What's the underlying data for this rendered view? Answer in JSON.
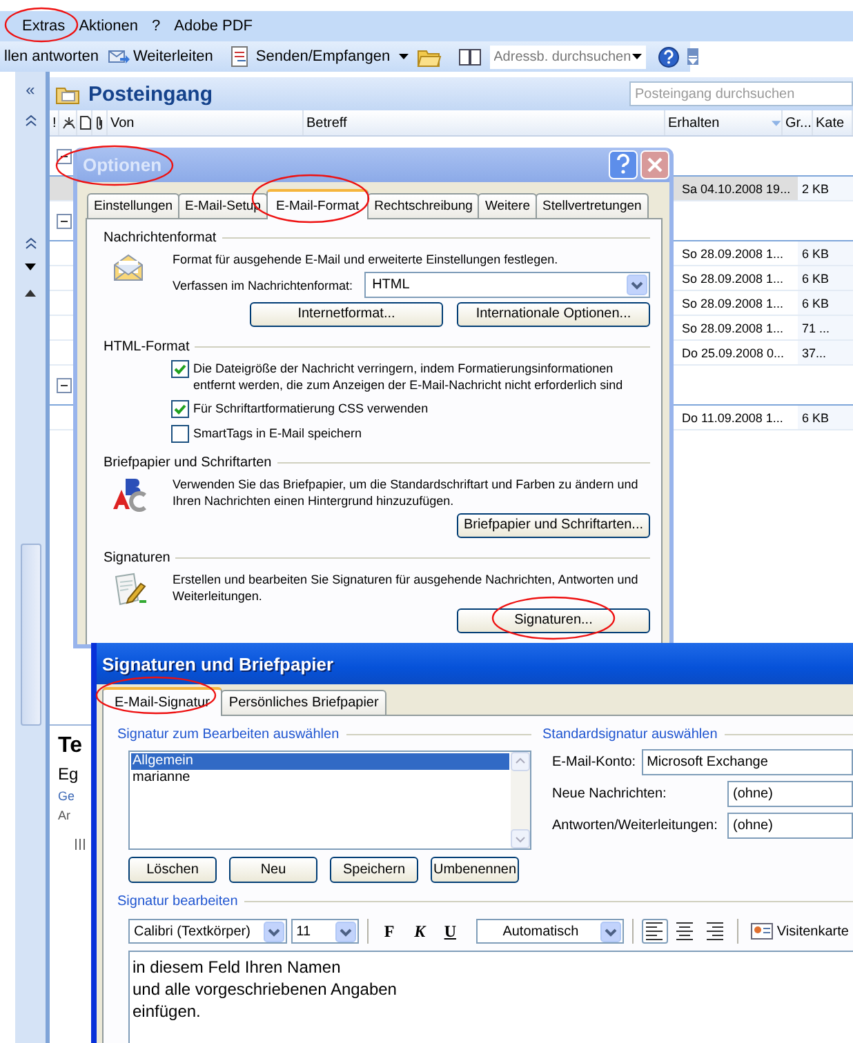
{
  "menu_bar": [
    {
      "label": "Extras"
    },
    {
      "label": "Aktionen"
    },
    {
      "label": "?"
    },
    {
      "label": "Adobe PDF"
    }
  ],
  "toolbar": {
    "reply_all": "llen antworten",
    "forward": "Weiterleiten",
    "send_receive": "Senden/Empfangen",
    "address_search": {
      "placeholder": "Adressb. durchsuchen"
    }
  },
  "navigation_pane": {
    "collapse": "«"
  },
  "inbox": {
    "title": "Posteingang",
    "search": {
      "placeholder": "Posteingang durchsuchen"
    },
    "columns": [
      "!",
      "Von",
      "Betreff",
      "Erhalten",
      "Gr...",
      "Kate"
    ],
    "rows": [
      {
        "kind": "group"
      },
      {
        "kind": "mail",
        "received": "Sa 04.10.2008 19...",
        "size": "2 KB",
        "selected": true
      },
      {
        "kind": "group"
      },
      {
        "kind": "mail",
        "received": "So 28.09.2008 1...",
        "size": "6 KB",
        "selected": false
      },
      {
        "kind": "mail",
        "received": "So 28.09.2008 1...",
        "size": "6 KB",
        "selected": false
      },
      {
        "kind": "mail",
        "received": "So 28.09.2008 1...",
        "size": "6 KB",
        "selected": false
      },
      {
        "kind": "mail",
        "received": "So 28.09.2008 1...",
        "size": "71 ...",
        "selected": false
      },
      {
        "kind": "mail",
        "received": "Do 25.09.2008 0...",
        "size": "37...",
        "selected": false
      },
      {
        "kind": "group"
      },
      {
        "kind": "mail",
        "received": "Do 11.09.2008 1...",
        "size": "6 KB",
        "selected": false
      }
    ]
  },
  "reading_pane": [
    {
      "kind": "subject",
      "text": "Te"
    },
    {
      "kind": "sender",
      "text": "Eg"
    },
    {
      "kind": "link",
      "text": "Ge"
    },
    {
      "kind": "meta",
      "text": "Ar"
    }
  ],
  "options_dialog": {
    "title": "Optionen",
    "tabs": [
      {
        "label": "Einstellungen",
        "selected": false
      },
      {
        "label": "E-Mail-Setup",
        "selected": false
      },
      {
        "label": "E-Mail-Format",
        "selected": true
      },
      {
        "label": "Rechtschreibung",
        "selected": false
      },
      {
        "label": "Weitere",
        "selected": false
      },
      {
        "label": "Stellvertretungen",
        "selected": false
      }
    ],
    "sections": [
      {
        "kind": "compose",
        "title": "Nachrichtenformat",
        "text": "Format für ausgehende E-Mail und erweiterte Einstellungen festlegen.",
        "format_label": "Verfassen im Nachrichtenformat:",
        "format_value": "HTML",
        "buttons": [
          "Internetformat...",
          "Internationale Optionen..."
        ]
      },
      {
        "kind": "checkboxes",
        "title": "HTML-Format",
        "checkboxes": [
          {
            "label": "Die Dateigröße der Nachricht verringern, indem Formatierungsinformationen entfernt werden, die zum Anzeigen der E-Mail-Nachricht nicht erforderlich sind",
            "checked": true
          },
          {
            "label": "Für Schriftartformatierung CSS verwenden",
            "checked": true
          },
          {
            "label": "SmartTags in E-Mail speichern",
            "checked": false
          }
        ]
      },
      {
        "kind": "stationery",
        "title": "Briefpapier und Schriftarten",
        "text": "Verwenden Sie das Briefpapier, um die Standardschriftart und Farben zu ändern und Ihren Nachrichten einen Hintergrund hinzuzufügen.",
        "buttons": [
          "Briefpapier und Schriftarten..."
        ]
      },
      {
        "kind": "signatures",
        "title": "Signaturen",
        "text": "Erstellen und bearbeiten Sie Signaturen für ausgehende Nachrichten, Antworten und Weiterleitungen.",
        "buttons": [
          "Signaturen..."
        ]
      }
    ]
  },
  "signature_dialog": {
    "title": "Signaturen und Briefpapier",
    "tabs": [
      {
        "label": "E-Mail-Signatur",
        "selected": true
      },
      {
        "label": "Persönliches Briefpapier",
        "selected": false
      }
    ],
    "select_signature": {
      "heading": "Signatur zum Bearbeiten auswählen",
      "items": [
        {
          "label": "Allgemein",
          "selected": true
        },
        {
          "label": "marianne",
          "selected": false
        }
      ],
      "buttons": [
        "Löschen",
        "Neu",
        "Speichern",
        "Umbenennen"
      ]
    },
    "default_signature": {
      "heading": "Standardsignatur auswählen",
      "fields": [
        {
          "label": "E-Mail-Konto:",
          "value": "Microsoft Exchange"
        },
        {
          "label": "Neue Nachrichten:",
          "value": "(ohne)"
        },
        {
          "label": "Antworten/Weiterleitungen:",
          "value": "(ohne)"
        }
      ]
    },
    "edit_signature": {
      "heading": "Signatur bearbeiten",
      "font": "Calibri (Textkörper)",
      "size": "11",
      "format_buttons": [
        {
          "kind": "bold",
          "label": "F"
        },
        {
          "kind": "italic",
          "label": "K"
        },
        {
          "kind": "underline",
          "label": "U"
        }
      ],
      "font_color": "Automatisch",
      "align_buttons": [
        {
          "kind": "left",
          "selected": true
        },
        {
          "kind": "center",
          "selected": false
        },
        {
          "kind": "right",
          "selected": false
        }
      ],
      "business_card": "Visitenkarte",
      "lines": [
        "in diesem Feld Ihren Namen",
        "und alle vorgeschriebenen Angaben",
        "einfügen."
      ]
    }
  }
}
